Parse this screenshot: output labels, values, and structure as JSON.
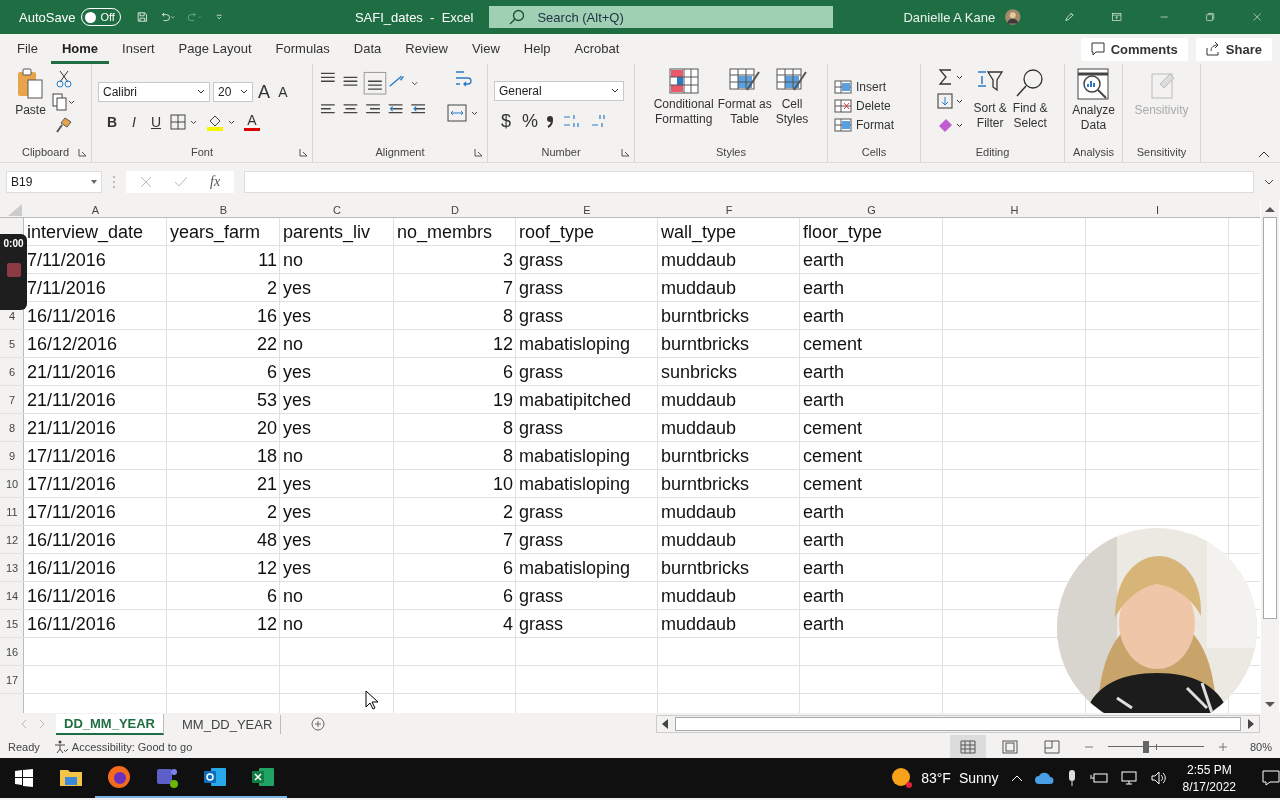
{
  "title_bar": {
    "autosave": {
      "label": "AutoSave",
      "on": false,
      "state_label": "Off"
    },
    "document_title": "SAFI_dates  -  Excel",
    "search": {
      "placeholder": "Search (Alt+Q)"
    },
    "user_name": "Danielle A Kane"
  },
  "menu_tabs": [
    {
      "label": "File",
      "selected": false
    },
    {
      "label": "Home",
      "selected": true
    },
    {
      "label": "Insert",
      "selected": false
    },
    {
      "label": "Page Layout",
      "selected": false
    },
    {
      "label": "Formulas",
      "selected": false
    },
    {
      "label": "Data",
      "selected": false
    },
    {
      "label": "Review",
      "selected": false
    },
    {
      "label": "View",
      "selected": false
    },
    {
      "label": "Help",
      "selected": false
    },
    {
      "label": "Acrobat",
      "selected": false
    }
  ],
  "comments_button": "Comments",
  "share_button": "Share",
  "ribbon": {
    "clipboard": {
      "paste": "Paste",
      "label": "Clipboard"
    },
    "font": {
      "font_name": "Calibri",
      "font_size": "20",
      "grow": "A",
      "shrink": "A",
      "styles": [
        "B",
        "I",
        "U"
      ],
      "font_color": "A",
      "label": "Font"
    },
    "alignment": {
      "label": "Alignment"
    },
    "number": {
      "format": "General",
      "currency": "$",
      "percent": "%",
      "label": "Number"
    },
    "styles": {
      "buttons": [
        {
          "lines": [
            "Conditional",
            "Formatting"
          ]
        },
        {
          "lines": [
            "Format as",
            "Table"
          ]
        },
        {
          "lines": [
            "Cell",
            "Styles"
          ]
        }
      ],
      "label": "Styles"
    },
    "cells": {
      "buttons": [
        "Insert",
        "Delete",
        "Format"
      ],
      "label": "Cells"
    },
    "editing": {
      "buttons": [
        {
          "lines": [
            "Sort &",
            "Filter"
          ]
        },
        {
          "lines": [
            "Find &",
            "Select"
          ]
        }
      ],
      "label": "Editing"
    },
    "analysis": {
      "button": {
        "lines": [
          "Analyze",
          "Data"
        ]
      },
      "label": "Analysis"
    },
    "sensitivity": {
      "button": "Sensitivity",
      "disabled": true,
      "label": "Sensitivity"
    }
  },
  "formula_bar": {
    "name_box": "B19",
    "function_label": "fx"
  },
  "recording": {
    "timer": "0:00"
  },
  "sheet": {
    "columns": [
      {
        "letter": "A",
        "kind": "text"
      },
      {
        "letter": "B",
        "kind": "number"
      },
      {
        "letter": "C",
        "kind": "text"
      },
      {
        "letter": "D",
        "kind": "number"
      },
      {
        "letter": "E",
        "kind": "text"
      },
      {
        "letter": "F",
        "kind": "text"
      },
      {
        "letter": "G",
        "kind": "text"
      },
      {
        "letter": "H",
        "kind": "text"
      },
      {
        "letter": "I",
        "kind": "text"
      }
    ],
    "rows": [
      {
        "kind": "header",
        "cells": [
          "interview_date",
          "years_farm",
          "parents_liv",
          "no_membrs",
          "roof_type",
          "wall_type",
          "floor_type"
        ]
      },
      {
        "kind": "data",
        "cells": [
          "7/11/2016",
          "11",
          "no",
          "3",
          "grass",
          "muddaub",
          "earth"
        ]
      },
      {
        "kind": "data",
        "cells": [
          "7/11/2016",
          "2",
          "yes",
          "7",
          "grass",
          "muddaub",
          "earth"
        ]
      },
      {
        "kind": "data",
        "number": "4",
        "cells": [
          "16/11/2016",
          "16",
          "yes",
          "8",
          "grass",
          "burntbricks",
          "earth"
        ]
      },
      {
        "kind": "data",
        "number": "5",
        "cells": [
          "16/12/2016",
          "22",
          "no",
          "12",
          "mabatisloping",
          "burntbricks",
          "cement"
        ]
      },
      {
        "kind": "data",
        "number": "6",
        "cells": [
          "21/11/2016",
          "6",
          "yes",
          "6",
          "grass",
          "sunbricks",
          "earth"
        ]
      },
      {
        "kind": "data",
        "number": "7",
        "cells": [
          "21/11/2016",
          "53",
          "yes",
          "19",
          "mabatipitched",
          "muddaub",
          "earth"
        ]
      },
      {
        "kind": "data",
        "number": "8",
        "cells": [
          "21/11/2016",
          "20",
          "yes",
          "8",
          "grass",
          "muddaub",
          "cement"
        ]
      },
      {
        "kind": "data",
        "number": "9",
        "cells": [
          "17/11/2016",
          "18",
          "no",
          "8",
          "mabatisloping",
          "burntbricks",
          "cement"
        ]
      },
      {
        "kind": "data",
        "number": "10",
        "cells": [
          "17/11/2016",
          "21",
          "yes",
          "10",
          "mabatisloping",
          "burntbricks",
          "cement"
        ]
      },
      {
        "kind": "data",
        "number": "11",
        "cells": [
          "17/11/2016",
          "2",
          "yes",
          "2",
          "grass",
          "muddaub",
          "earth"
        ]
      },
      {
        "kind": "data",
        "number": "12",
        "cells": [
          "16/11/2016",
          "48",
          "yes",
          "7",
          "grass",
          "muddaub",
          "earth"
        ]
      },
      {
        "kind": "data",
        "number": "13",
        "cells": [
          "16/11/2016",
          "12",
          "yes",
          "6",
          "mabatisloping",
          "burntbricks",
          "earth"
        ]
      },
      {
        "kind": "data",
        "number": "14",
        "cells": [
          "16/11/2016",
          "6",
          "no",
          "6",
          "grass",
          "muddaub",
          "earth"
        ]
      },
      {
        "kind": "data",
        "number": "15",
        "cells": [
          "16/11/2016",
          "12",
          "no",
          "4",
          "grass",
          "muddaub",
          "earth"
        ]
      },
      {
        "kind": "data",
        "number": "16",
        "cells": []
      },
      {
        "kind": "data",
        "number": "17",
        "cells": []
      }
    ]
  },
  "sheet_tabs": [
    {
      "label": "DD_MM_YEAR",
      "selected": true
    },
    {
      "label": "MM_DD_YEAR",
      "selected": false
    }
  ],
  "status_bar": {
    "ready": "Ready",
    "accessibility": "Accessibility: Good to go",
    "views": [
      {
        "kind": "normal",
        "selected": true
      },
      {
        "kind": "page-layout",
        "selected": false
      },
      {
        "kind": "page-break",
        "selected": false
      }
    ],
    "zoom": {
      "level": 0.4,
      "reading": "80%"
    }
  },
  "taskbar": {
    "weather": {
      "temperature": "83°F",
      "condition": "Sunny"
    },
    "time": "2:55 PM",
    "date": "8/17/2022"
  }
}
